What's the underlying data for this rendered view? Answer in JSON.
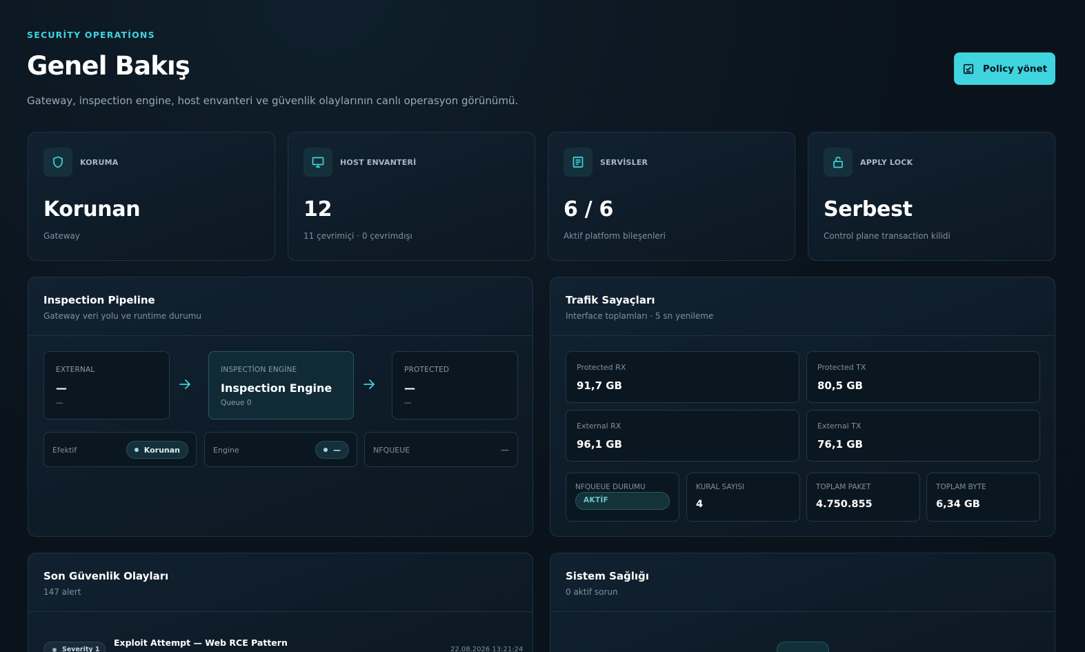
{
  "header": {
    "eyebrow": "SECURİTY OPERATİONS",
    "title": "Genel Bakış",
    "subtitle": "Gateway, inspection engine, host envanteri ve güvenlik olaylarının canlı operasyon görünümü.",
    "policy_button": "Policy yönet"
  },
  "stats": [
    {
      "label": "KORUMA",
      "value": "Korunan",
      "sub": "Gateway",
      "icon": "shield-icon"
    },
    {
      "label": "HOST ENVANTERİ",
      "value": "12",
      "sub": "11 çevrimiçi · 0 çevrimdışı",
      "icon": "monitor-icon"
    },
    {
      "label": "SERVİSLER",
      "value": "6 / 6",
      "sub": "Aktif platform bileşenleri",
      "icon": "document-icon"
    },
    {
      "label": "APPLY LOCK",
      "value": "Serbest",
      "sub": "Control plane transaction kilidi",
      "icon": "unlock-icon"
    }
  ],
  "pipeline": {
    "title": "Inspection Pipeline",
    "subtitle": "Gateway veri yolu ve runtime durumu",
    "nodes": [
      {
        "label": "EXTERNAL",
        "value": "—",
        "sub": "—"
      },
      {
        "label": "INSPECTİON ENGİNE",
        "value": "Inspection Engine",
        "sub": "Queue 0"
      },
      {
        "label": "PROTECTED",
        "value": "—",
        "sub": "—"
      }
    ],
    "chips": [
      {
        "label": "Efektif",
        "value": "Korunan"
      },
      {
        "label": "Engine",
        "value": "—"
      },
      {
        "label": "NFQUEUE",
        "value": "—"
      }
    ]
  },
  "traffic": {
    "title": "Trafik Sayaçları",
    "subtitle": "Interface toplamları · 5 sn yenileme",
    "counters": [
      {
        "label": "Protected RX",
        "value": "91,7 GB"
      },
      {
        "label": "Protected TX",
        "value": "80,5 GB"
      },
      {
        "label": "External RX",
        "value": "96,1 GB"
      },
      {
        "label": "External TX",
        "value": "76,1 GB"
      }
    ],
    "summary": [
      {
        "label": "NFQUEUE DURUMU",
        "value": "AKTİF"
      },
      {
        "label": "KURAL SAYISI",
        "value": "4"
      },
      {
        "label": "TOPLAM PAKET",
        "value": "4.750.855"
      },
      {
        "label": "TOPLAM BYTE",
        "value": "6,34 GB"
      }
    ]
  },
  "events": {
    "title": "Son Güvenlik Olayları",
    "subtitle": "147 alert",
    "first": {
      "severity": "Severity 1",
      "title": "Exploit Attempt — Web RCE Pattern",
      "time": "22.08.2026 13:21:24"
    }
  },
  "health": {
    "title": "Sistem Sağlığı",
    "subtitle": "0 aktif sorun"
  },
  "colors": {
    "accent": "#3fd4de",
    "background": "#0a131c",
    "card": "#0f1d29"
  }
}
